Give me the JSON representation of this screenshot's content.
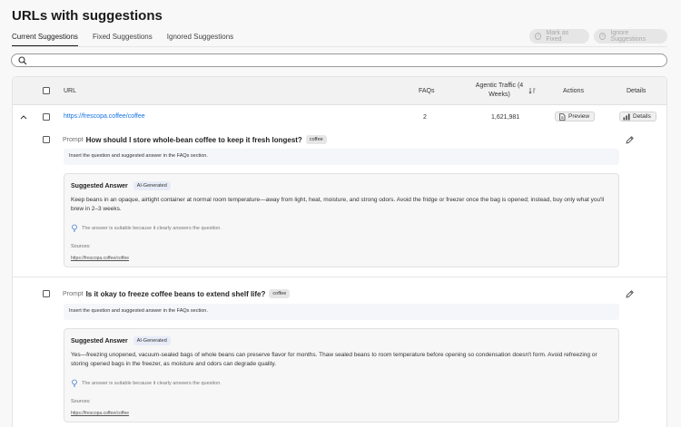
{
  "page_title": "URLs with suggestions",
  "tabs": [
    {
      "label": "Current Suggestions"
    },
    {
      "label": "Fixed Suggestions"
    },
    {
      "label": "Ignored Suggestions"
    }
  ],
  "actions": {
    "mark_fixed": "Mark as Fixed",
    "ignore": "Ignore Suggestions"
  },
  "search": {
    "placeholder": ""
  },
  "table": {
    "headers": {
      "url": "URL",
      "faqs": "FAQs",
      "traffic": "Agentic Traffic (4 Weeks)",
      "actions": "Actions",
      "details": "Details"
    },
    "row": {
      "url": "https://frescopa.coffee/coffee",
      "faqs": "2",
      "traffic": "1,621,981",
      "preview": "Preview",
      "details": "Details"
    }
  },
  "suggestions": [
    {
      "prompt_label": "Prompt",
      "question": "How should I store whole-bean coffee to keep it fresh longest?",
      "tag": "coffee",
      "hint": "Insert the question and suggested answer in the FAQs section.",
      "card_title": "Suggested Answer",
      "badge": "AI-Generated",
      "answer": "Keep beans in an opaque, airtight container at normal room temperature—away from light, heat, moisture, and strong odors. Avoid the fridge or freezer once the bag is opened; instead, buy only what you'll brew in 2–3 weeks.",
      "reason": "The answer is suitable because it clearly answers the question.",
      "sources_label": "Sources:",
      "source": "https://frescopa.coffee/coffee"
    },
    {
      "prompt_label": "Prompt",
      "question": "Is it okay to freeze coffee beans to extend shelf life?",
      "tag": "coffee",
      "hint": "Insert the question and suggested answer in the FAQs section.",
      "card_title": "Suggested Answer",
      "badge": "AI-Generated",
      "answer": "Yes—freezing unopened, vacuum-sealed bags of whole beans can preserve flavor for months. Thaw sealed beans to room temperature before opening so condensation doesn't form. Avoid refreezing or storing opened bags in the freezer, as moisture and odors can degrade quality.",
      "reason": "The answer is suitable because it clearly answers the question.",
      "sources_label": "Sources:",
      "source": "https://frescopa.coffee/coffee"
    }
  ]
}
